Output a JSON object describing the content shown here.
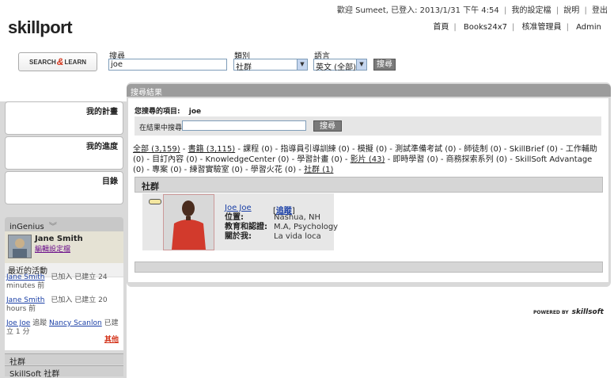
{
  "header": {
    "welcome_text": "歡迎  Sumeet, 已登入: 2013/1/31 下午 4:54",
    "my_settings": "我的設定檔",
    "help": "說明",
    "logout": "登出",
    "logo_text": "skillport",
    "nav": [
      "首頁",
      "Books24x7",
      "核准管理員",
      "Admin"
    ]
  },
  "search": {
    "logo_left": "SEARCH",
    "logo_amp": "&",
    "logo_right": "LEARN",
    "search_label": "搜尋",
    "search_value": "joe",
    "category_label": "類別",
    "category_value": "社群",
    "language_label": "語言",
    "language_value": "英文 (全部)",
    "search_button": "搜尋"
  },
  "sidebar": {
    "my_plan": "我的計畫",
    "my_progress": "我的進度",
    "catalog": "目錄",
    "ingenius_title": "inGenius",
    "profile_name": "Jane Smith",
    "edit_profile": "編輯設定檔",
    "recent_activity": "最近的活動",
    "activities": [
      {
        "name": "Jane Smith",
        "action": "已加入 已建立 24 minutes 前"
      },
      {
        "name": "Jane Smith",
        "action": "已加入 已建立 20 hours 前"
      },
      {
        "name": "Joe Joe",
        "verb": "追蹤",
        "target": "Nancy Scanlon",
        "action": "已建立 1 分"
      }
    ],
    "more": "其他",
    "tab_social": "社群",
    "tab_skillsoft_social": "SkillSoft 社群"
  },
  "main": {
    "title": "搜尋結果",
    "searched_label": "您搜尋的項目:",
    "searched_term": "joe",
    "refine_label": "在結果中搜尋",
    "refine_button": "搜尋",
    "categories_text": [
      {
        "t": "全部 (3,159)",
        "link": true
      },
      {
        "t": " - ",
        "link": false
      },
      {
        "t": "書籍 (3,115)",
        "link": true
      },
      {
        "t": " - 課程 (0) - 指導員引導訓練 (0) - 模擬 (0) - 測試準備考試 (0) - 師徒制 (0) - SkillBrief (0) - 工作輔助 (0) - 目訂內容 (0) - KnowledgeCenter (0) - 學習計畫 (0) - ",
        "link": false
      },
      {
        "t": "影片 (43)",
        "link": true
      },
      {
        "t": " - 即時學習 (0) - 商務探索系列 (0) - SkillSoft Advantage (0) - 專案 (0) - 練習實驗室 (0) - 學習火花 (0) - ",
        "link": false
      },
      {
        "t": "社群 (1)",
        "link": true
      }
    ],
    "section_title": "社群",
    "result": {
      "name": "Joe Joe",
      "follow": "追蹤",
      "location_label": "位置:",
      "location_value": "Nashua, NH",
      "education_label": "教育和認證:",
      "education_value": "M.A, Psychology",
      "about_label": "關於我:",
      "about_value": "La vida loca"
    }
  },
  "footer": {
    "powered_by": "POWERED BY",
    "brand": "skillsoft"
  }
}
